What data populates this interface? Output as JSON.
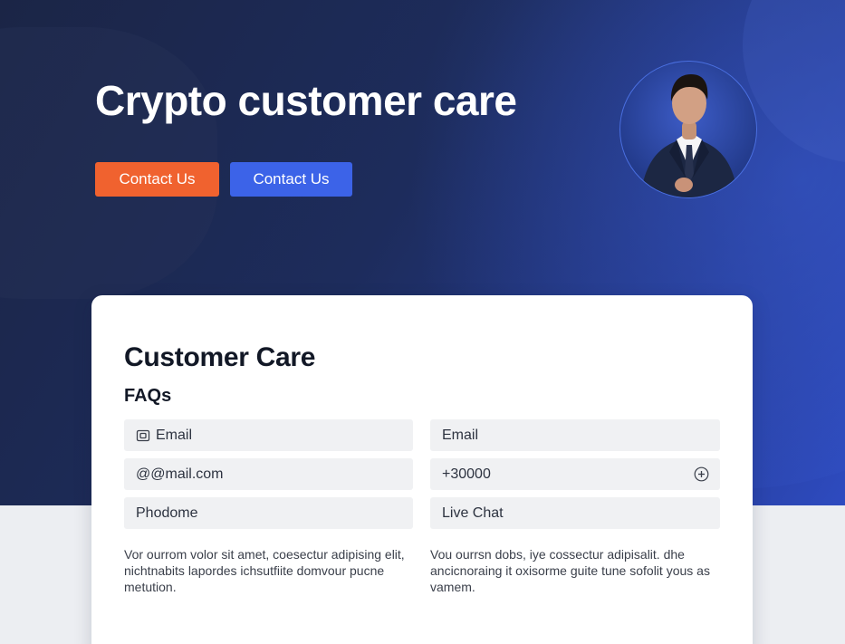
{
  "hero": {
    "title": "Crypto customer care",
    "buttons": [
      {
        "label": "Contact Us",
        "color": "#f0622f"
      },
      {
        "label": "Contact Us",
        "color": "#3c63e8"
      }
    ]
  },
  "card": {
    "title": "Customer Care",
    "subtitle": "FAQs",
    "fields": {
      "left": [
        {
          "value": "Email",
          "icon": "email-icon"
        },
        {
          "value": "@@mail.com"
        },
        {
          "value": "Phodome"
        }
      ],
      "right": [
        {
          "value": "Email"
        },
        {
          "value": "+30000",
          "icon": "plus-circle-icon"
        },
        {
          "value": "Live Chat"
        }
      ]
    },
    "paragraphs": [
      "Vor ourrom volor sit amet, coesectur adipising elit, nichtnabits lapordes ichsutfiite domvour pucne metution.",
      "Vou ourrsn dobs, iye cossectur adipisalit. dhe ancicnoraing it oxisorme guite tune sofolit yous as vamem."
    ]
  },
  "colors": {
    "hero_gradient_start": "#1b2546",
    "hero_gradient_end": "#2e4bc0",
    "card_bg": "#ffffff",
    "field_bg": "#f0f1f3"
  }
}
